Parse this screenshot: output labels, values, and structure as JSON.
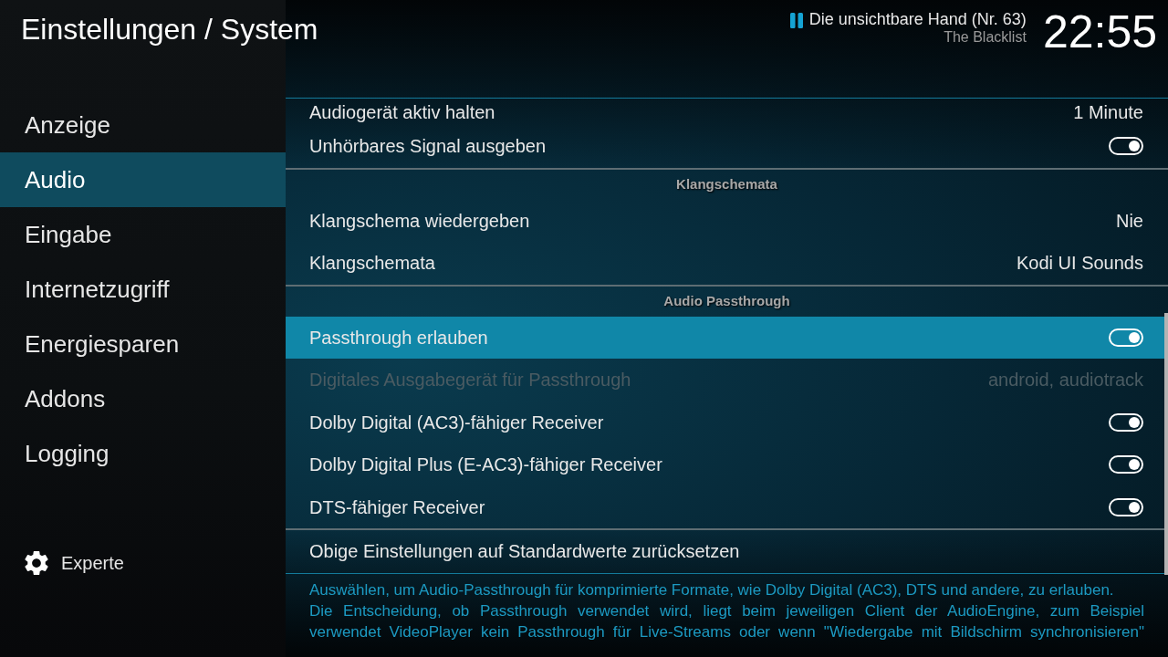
{
  "header": {
    "title": "Einstellungen / System"
  },
  "now_playing": {
    "title": "Die unsichtbare Hand (Nr. 63)",
    "show": "The Blacklist"
  },
  "clock": "22:55",
  "sidebar": {
    "items": [
      {
        "label": "Anzeige",
        "selected": false
      },
      {
        "label": "Audio",
        "selected": true
      },
      {
        "label": "Eingabe",
        "selected": false
      },
      {
        "label": "Internetzugriff",
        "selected": false
      },
      {
        "label": "Energiesparen",
        "selected": false
      },
      {
        "label": "Addons",
        "selected": false
      },
      {
        "label": "Logging",
        "selected": false
      }
    ],
    "settings_level": "Experte"
  },
  "settings": {
    "groups": [
      {
        "rows": [
          {
            "kind": "value",
            "label": "Audiogerät aktiv halten",
            "value": "1 Minute",
            "selected": false,
            "disabled": false
          },
          {
            "kind": "toggle",
            "label": "Unhörbares Signal ausgeben",
            "on": true,
            "selected": false,
            "disabled": false
          }
        ]
      },
      {
        "title": "Klangschemata",
        "rows": [
          {
            "kind": "value",
            "label": "Klangschema wiedergeben",
            "value": "Nie",
            "selected": false,
            "disabled": false
          },
          {
            "kind": "value",
            "label": "Klangschemata",
            "value": "Kodi UI Sounds",
            "selected": false,
            "disabled": false
          }
        ]
      },
      {
        "title": "Audio Passthrough",
        "rows": [
          {
            "kind": "toggle",
            "label": "Passthrough erlauben",
            "on": true,
            "selected": true,
            "disabled": false
          },
          {
            "kind": "value",
            "label": "Digitales Ausgabegerät für Passthrough",
            "value": "android, audiotrack",
            "selected": false,
            "disabled": true
          },
          {
            "kind": "toggle",
            "label": "Dolby Digital (AC3)-fähiger Receiver",
            "on": true,
            "selected": false,
            "disabled": false
          },
          {
            "kind": "toggle",
            "label": "Dolby Digital Plus (E-AC3)-fähiger Receiver",
            "on": true,
            "selected": false,
            "disabled": false
          },
          {
            "kind": "toggle",
            "label": "DTS-fähiger Receiver",
            "on": true,
            "selected": false,
            "disabled": false
          }
        ]
      },
      {
        "rows": [
          {
            "kind": "action",
            "label": "Obige Einstellungen auf Standardwerte zurücksetzen",
            "selected": false,
            "disabled": false
          }
        ]
      }
    ]
  },
  "description": [
    "Auswählen, um Audio-Passthrough für komprimierte Formate, wie Dolby Digital (AC3), DTS und andere, zu erlauben.",
    "Die Entscheidung, ob Passthrough verwendet wird, liegt beim jeweiligen Client der AudioEngine, zum Beispiel verwendet VideoPlayer kein Passthrough für Live-Streams oder wenn \"Wiedergabe mit Bildschirm synchronisieren\""
  ]
}
